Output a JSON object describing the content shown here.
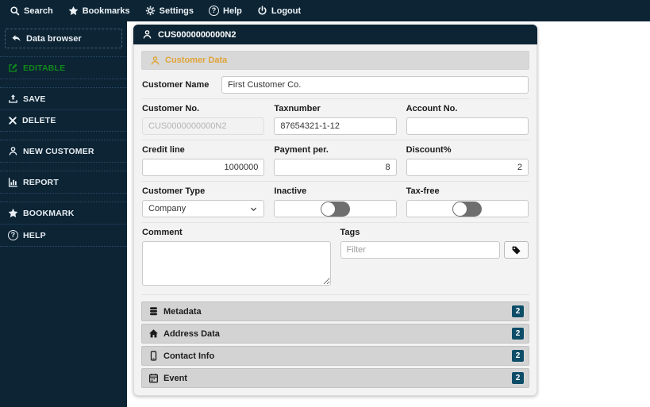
{
  "topbar": {
    "items": [
      {
        "label": "Search",
        "icon": "search-icon"
      },
      {
        "label": "Bookmarks",
        "icon": "star-icon"
      },
      {
        "label": "Settings",
        "icon": "gear-icon"
      },
      {
        "label": "Help",
        "icon": "help-icon"
      },
      {
        "label": "Logout",
        "icon": "power-icon"
      }
    ]
  },
  "sidebar": {
    "back_button": {
      "label": "Data browser",
      "icon": "reply-icon"
    },
    "status": {
      "label": "EDITABLE",
      "icon": "edit-icon",
      "color": "#12891c"
    },
    "items": [
      {
        "label": "SAVE",
        "icon": "upload-icon"
      },
      {
        "label": "DELETE",
        "icon": "x-icon"
      },
      {
        "label": "NEW CUSTOMER",
        "icon": "person-icon"
      },
      {
        "label": "REPORT",
        "icon": "chart-icon"
      },
      {
        "label": "BOOKMARK",
        "icon": "star-icon"
      },
      {
        "label": "HELP",
        "icon": "help-icon"
      }
    ]
  },
  "card": {
    "title_id": "CUS0000000000N2",
    "section_title": "Customer Data",
    "fields": {
      "customer_name": {
        "label": "Customer Name",
        "value": "First Customer Co."
      },
      "customer_no": {
        "label": "Customer No.",
        "value": "CUS0000000000N2",
        "disabled": true
      },
      "taxnumber": {
        "label": "Taxnumber",
        "value": "87654321-1-12"
      },
      "account_no": {
        "label": "Account No.",
        "value": ""
      },
      "credit_line": {
        "label": "Credit line",
        "value": "1000000"
      },
      "payment_per": {
        "label": "Payment per.",
        "value": "8"
      },
      "discount": {
        "label": "Discount%",
        "value": "2"
      },
      "customer_type": {
        "label": "Customer Type",
        "value": "Company"
      },
      "inactive": {
        "label": "Inactive",
        "value": "off"
      },
      "tax_free": {
        "label": "Tax-free",
        "value": "off"
      },
      "comment": {
        "label": "Comment",
        "value": ""
      },
      "tags": {
        "label": "Tags",
        "placeholder": "Filter",
        "button_icon": "tag-icon"
      }
    },
    "accordions": [
      {
        "label": "Metadata",
        "count": "2",
        "icon": "database-icon"
      },
      {
        "label": "Address Data",
        "count": "2",
        "icon": "home-icon"
      },
      {
        "label": "Contact Info",
        "count": "2",
        "icon": "mobile-icon"
      },
      {
        "label": "Event",
        "count": "2",
        "icon": "calendar-icon"
      }
    ]
  },
  "colors": {
    "navy": "#0c2434",
    "accent_orange": "#dfa437",
    "editable_green": "#12891c",
    "badge_teal": "#0d4d68",
    "section_gray": "#d8d8d8"
  }
}
